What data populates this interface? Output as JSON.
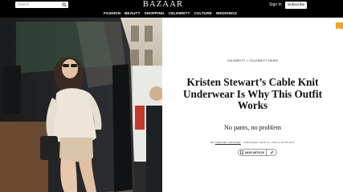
{
  "header": {
    "search_placeholder": "Search",
    "logo": "BAZAAR",
    "nav": [
      "FASHION",
      "BEAUTY",
      "SHOPPING",
      "CELEBRITY",
      "CULTURE",
      "WEDDINGS"
    ],
    "signin": "Sign In",
    "subscribe": "Subscribe"
  },
  "article": {
    "kicker": "CELEBRITY × CELEBRITY NEWS",
    "headline": "Kristen Stewart’s Cable Knit Underwear Is Why This Outfit Works",
    "dek": "No pants, no problem",
    "byline_prefix": "BY",
    "author": "CHELSEY SANCHEZ",
    "published": "PUBLISHED: MAR 12, 2024 3:18 PM EDT",
    "save_label": "SAVE ARTICLE"
  },
  "icons": {
    "search": "search-icon",
    "bookmark": "bookmark-icon",
    "share": "link-icon",
    "ad": "ad-choices-icon"
  },
  "colors": {
    "header_bg": "#000000",
    "accent_ad": "#f7a21b"
  }
}
